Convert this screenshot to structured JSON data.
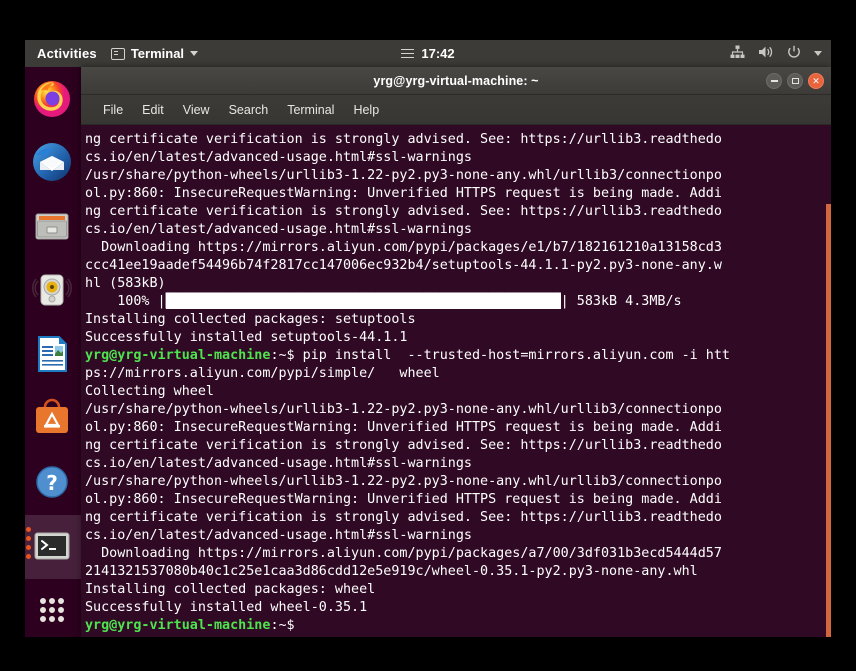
{
  "topbar": {
    "activities": "Activities",
    "app_name": "Terminal",
    "app_icon": "terminal-icon",
    "clock": "17:42",
    "calendar_icon": "hamburger-calendar-icon",
    "indicators": [
      "network-icon",
      "volume-icon",
      "power-icon",
      "chevron-down-icon"
    ]
  },
  "dock": {
    "items": [
      {
        "name": "firefox",
        "label": "Firefox",
        "active": false
      },
      {
        "name": "thunderbird",
        "label": "Thunderbird Mail",
        "active": false
      },
      {
        "name": "files",
        "label": "Files",
        "active": false
      },
      {
        "name": "rhythmbox",
        "label": "Rhythmbox",
        "active": false
      },
      {
        "name": "libreoffice-writer",
        "label": "LibreOffice Writer",
        "active": false
      },
      {
        "name": "ubuntu-software",
        "label": "Ubuntu Software",
        "active": false
      },
      {
        "name": "help",
        "label": "Help",
        "active": false
      },
      {
        "name": "terminal",
        "label": "Terminal",
        "active": true
      },
      {
        "name": "show-applications",
        "label": "Show Applications",
        "active": false
      }
    ]
  },
  "window": {
    "title": "yrg@yrg-virtual-machine: ~",
    "buttons": {
      "minimize": "minimize-button",
      "maximize": "maximize-button",
      "close": "close-button"
    },
    "menu": [
      "File",
      "Edit",
      "View",
      "Search",
      "Terminal",
      "Help"
    ]
  },
  "terminal": {
    "prompt_user_host": "yrg@yrg-virtual-machine",
    "prompt_path": ":~$",
    "progress": {
      "percent": "100%",
      "size": "583kB",
      "speed": "4.3MB/s"
    },
    "lines": [
      "ng certificate verification is strongly advised. See: https://urllib3.readthedo",
      "cs.io/en/latest/advanced-usage.html#ssl-warnings",
      "/usr/share/python-wheels/urllib3-1.22-py2.py3-none-any.whl/urllib3/connectionpo",
      "ol.py:860: InsecureRequestWarning: Unverified HTTPS request is being made. Addi",
      "ng certificate verification is strongly advised. See: https://urllib3.readthedo",
      "cs.io/en/latest/advanced-usage.html#ssl-warnings",
      "  Downloading https://mirrors.aliyun.com/pypi/packages/e1/b7/182161210a13158cd3",
      "ccc41ee19aadef54496b74f2817cc147006ec932b4/setuptools-44.1.1-py2.py3-none-any.w",
      "hl (583kB)",
      "PROGRESS_BAR",
      "Installing collected packages: setuptools",
      "Successfully installed setuptools-44.1.1",
      "PROMPT_CMD",
      "ps://mirrors.aliyun.com/pypi/simple/   wheel",
      "Collecting wheel",
      "/usr/share/python-wheels/urllib3-1.22-py2.py3-none-any.whl/urllib3/connectionpo",
      "ol.py:860: InsecureRequestWarning: Unverified HTTPS request is being made. Addi",
      "ng certificate verification is strongly advised. See: https://urllib3.readthedo",
      "cs.io/en/latest/advanced-usage.html#ssl-warnings",
      "/usr/share/python-wheels/urllib3-1.22-py2.py3-none-any.whl/urllib3/connectionpo",
      "ol.py:860: InsecureRequestWarning: Unverified HTTPS request is being made. Addi",
      "ng certificate verification is strongly advised. See: https://urllib3.readthedo",
      "cs.io/en/latest/advanced-usage.html#ssl-warnings",
      "  Downloading https://mirrors.aliyun.com/pypi/packages/a7/00/3df031b3ecd5444d57",
      "2141321537080b40c1c25e1caa3d86cdd12e5e919c/wheel-0.35.1-py2.py3-none-any.whl",
      "Installing collected packages: wheel",
      "Successfully installed wheel-0.35.1",
      "PROMPT_ONLY"
    ],
    "command": " pip install  --trusted-host=mirrors.aliyun.com -i htt"
  }
}
